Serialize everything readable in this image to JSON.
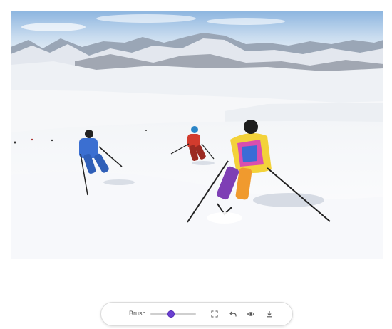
{
  "photo": {
    "subject": "skiers-on-snowy-slope"
  },
  "toolbar": {
    "brush_label": "Brush",
    "brush_value": 0.45,
    "accent": "#6a3fd1",
    "tools": [
      "expand-icon",
      "undo-icon",
      "eye-icon",
      "download-icon"
    ]
  }
}
